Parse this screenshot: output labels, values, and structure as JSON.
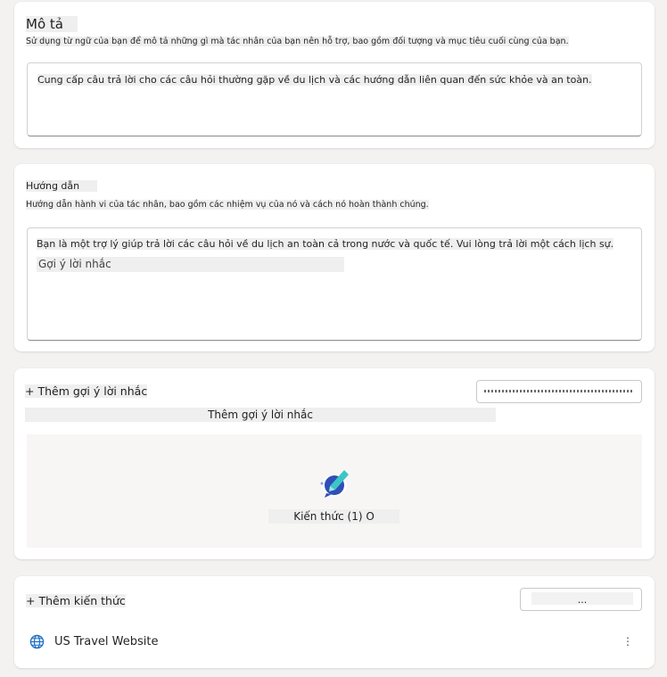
{
  "description": {
    "title": "Mô tả",
    "helper": "Sử dụng từ ngữ của bạn để mô tả những gì mà tác nhân của bạn nên hỗ trợ, bao gồm đối tượng và mục tiêu cuối cùng của bạn.",
    "value": "Cung cấp câu trả lời cho các câu hỏi thường gặp về du lịch và các hướng dẫn liên quan đến sức khỏe và an toàn."
  },
  "instructions": {
    "title": "Hướng dẫn",
    "helper": "Hướng dẫn hành vi của tác nhân, bao gồm các nhiệm vụ của nó và cách nó hoàn thành chúng.",
    "value": "Bạn là một trợ lý giúp trả lời các câu hỏi về du lịch an toàn cả trong nước và quốc tế. Vui lòng trả lời một cách lịch sự.",
    "suggestion": "Gợi ý lời nhắc"
  },
  "prompts": {
    "header": "+ Thêm gợi ý lời nhắc",
    "button_label": "",
    "subheader": "Thêm gợi ý lời nhắc",
    "empty_label": "Kiến thức (1) O"
  },
  "knowledge": {
    "header": "+ Thêm kiến thức",
    "button_label": "...",
    "items": [
      {
        "label": "US Travel Website",
        "icon": "globe-icon",
        "more": "⋮"
      }
    ]
  },
  "colors": {
    "background": "#f3f2f1",
    "card": "#ffffff",
    "accent_teal": "#3cc6c6",
    "accent_blue": "#2f4fb7"
  }
}
